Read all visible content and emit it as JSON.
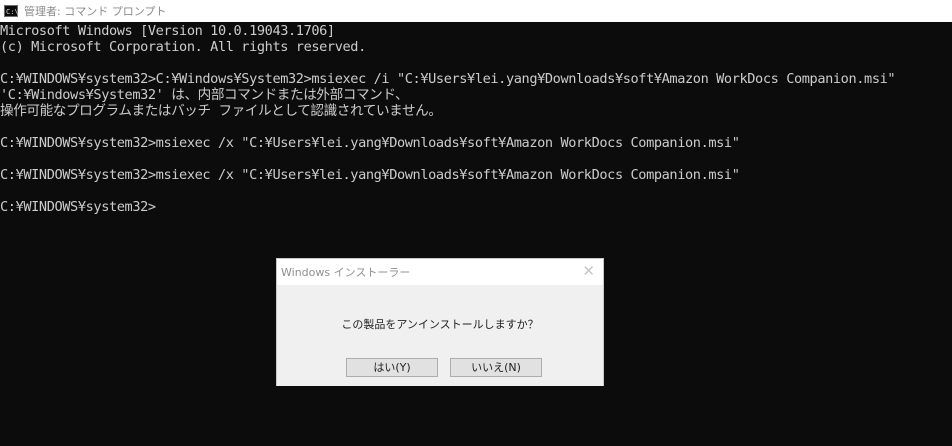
{
  "window": {
    "icon": "cmd-icon",
    "icon_text": "C:\\",
    "title": "管理者: コマンド プロンプト"
  },
  "console": {
    "lines": [
      "Microsoft Windows [Version 10.0.19043.1706]",
      "(c) Microsoft Corporation. All rights reserved.",
      "",
      "C:¥WINDOWS¥system32>C:¥Windows¥System32>msiexec /i \"C:¥Users¥lei.yang¥Downloads¥soft¥Amazon WorkDocs Companion.msi\"",
      "'C:¥Windows¥System32' は、内部コマンドまたは外部コマンド、",
      "操作可能なプログラムまたはバッチ ファイルとして認識されていません。",
      "",
      "C:¥WINDOWS¥system32>msiexec /x \"C:¥Users¥lei.yang¥Downloads¥soft¥Amazon WorkDocs Companion.msi\"",
      "",
      "C:¥WINDOWS¥system32>msiexec /x \"C:¥Users¥lei.yang¥Downloads¥soft¥Amazon WorkDocs Companion.msi\"",
      "",
      "C:¥WINDOWS¥system32>"
    ]
  },
  "dialog": {
    "title": "Windows インストーラー",
    "close_icon": "close-icon",
    "message": "この製品をアンインストールしますか？",
    "yes_label": "はい(Y)",
    "no_label": "いいえ(N)"
  }
}
